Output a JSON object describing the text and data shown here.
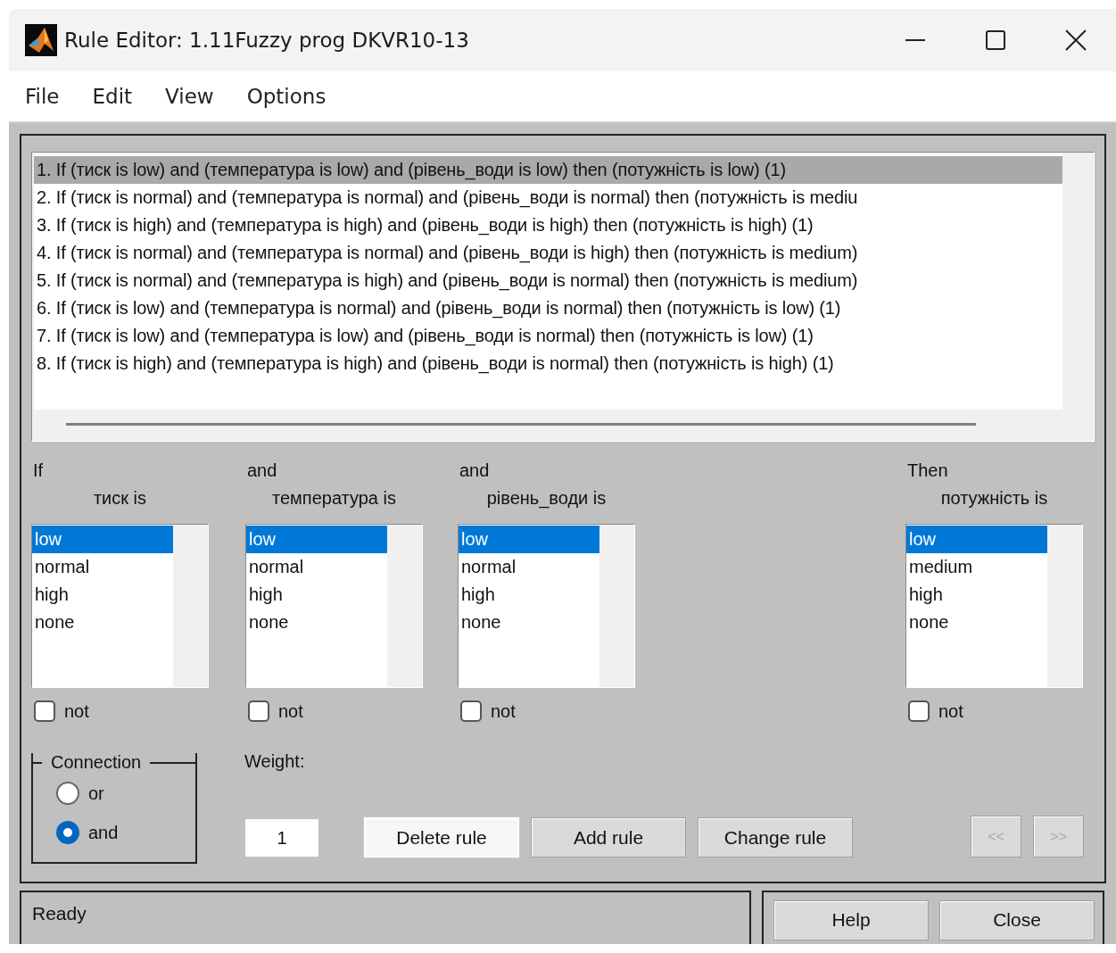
{
  "window": {
    "title": "Rule Editor: 1.11Fuzzy prog DKVR10-13"
  },
  "menu": [
    "File",
    "Edit",
    "View",
    "Options"
  ],
  "rules": [
    {
      "text": "1. If (тиск is low) and (температура is low) and (рівень_води is low) then (потужність is low) (1)",
      "selected": true
    },
    {
      "text": "2. If (тиск is normal) and (температура is normal) and (рівень_води is normal) then (потужність is mediu",
      "selected": false
    },
    {
      "text": "3. If (тиск is high) and (температура is high) and (рівень_води is high) then (потужність is high) (1)",
      "selected": false
    },
    {
      "text": "4. If (тиск is normal) and (температура is normal) and (рівень_води is high) then (потужність is medium)",
      "selected": false
    },
    {
      "text": "5. If (тиск is normal) and (температура is high) and (рівень_води is normal) then (потужність is medium)",
      "selected": false
    },
    {
      "text": "6. If (тиск is low) and (температура is normal) and (рівень_води is normal) then (потужність is low) (1)",
      "selected": false
    },
    {
      "text": "7. If (тиск is low) and (температура is low) and (рівень_води is normal) then (потужність is low) (1)",
      "selected": false
    },
    {
      "text": "8. If (тиск is high) and (температура is high) and (рівень_води is normal) then (потужність is high) (1)",
      "selected": false
    }
  ],
  "variables": [
    {
      "connector": "If",
      "label": "тиск is",
      "not_label": "not",
      "not": false,
      "options": [
        {
          "label": "low",
          "selected": true
        },
        {
          "label": "normal",
          "selected": false
        },
        {
          "label": "high",
          "selected": false
        },
        {
          "label": "none",
          "selected": false
        }
      ]
    },
    {
      "connector": "and",
      "label": "температура is",
      "not_label": "not",
      "not": false,
      "options": [
        {
          "label": "low",
          "selected": true
        },
        {
          "label": "normal",
          "selected": false
        },
        {
          "label": "high",
          "selected": false
        },
        {
          "label": "none",
          "selected": false
        }
      ]
    },
    {
      "connector": "and",
      "label": "рівень_води is",
      "not_label": "not",
      "not": false,
      "options": [
        {
          "label": "low",
          "selected": true
        },
        {
          "label": "normal",
          "selected": false
        },
        {
          "label": "high",
          "selected": false
        },
        {
          "label": "none",
          "selected": false
        }
      ]
    },
    {
      "connector": "Then",
      "label": "потужність is",
      "not_label": "not",
      "not": false,
      "options": [
        {
          "label": "low",
          "selected": true
        },
        {
          "label": "medium",
          "selected": false
        },
        {
          "label": "high",
          "selected": false
        },
        {
          "label": "none",
          "selected": false
        }
      ]
    }
  ],
  "connection": {
    "title": "Connection",
    "options": [
      {
        "label": "or",
        "selected": false
      },
      {
        "label": "and",
        "selected": true
      }
    ]
  },
  "weight": {
    "label": "Weight:",
    "value": "1"
  },
  "buttons": [
    {
      "label": "Delete rule",
      "focused": true
    },
    {
      "label": "Add rule",
      "focused": false
    },
    {
      "label": "Change rule",
      "focused": false
    }
  ],
  "nav_buttons": [
    {
      "label": "<<",
      "disabled": true
    },
    {
      "label": ">>",
      "disabled": true
    }
  ],
  "status": "Ready",
  "footer_buttons": [
    "Help",
    "Close"
  ]
}
